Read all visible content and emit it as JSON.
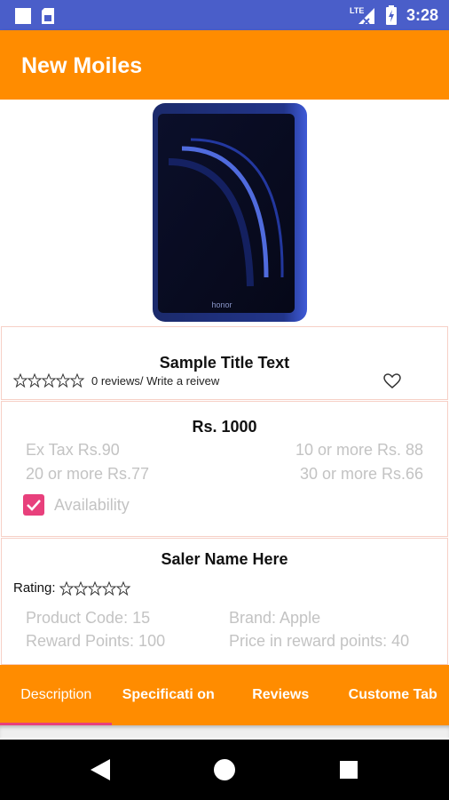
{
  "status_bar": {
    "time": "3:28",
    "network": "LTE",
    "icons": [
      "notification-square-icon",
      "sim-card-icon",
      "signal-icon",
      "battery-charging-icon"
    ]
  },
  "app_bar": {
    "title": "New Moiles"
  },
  "product": {
    "image": "honor-phone",
    "brand_logo_text": "honor",
    "title": "Sample Title Text",
    "rating_stars": 0,
    "reviews_text": "0 reviews/ Write a reivew",
    "price": "Rs. 1000",
    "ex_tax": "Ex Tax Rs.90",
    "bulk_10": "10 or more Rs. 88",
    "bulk_20": "20 or more Rs.77",
    "bulk_30": "30 or more Rs.66",
    "availability_label": "Availability",
    "availability_checked": true
  },
  "seller": {
    "name": "Saler Name Here",
    "rating_label": "Rating:",
    "rating_stars": 0,
    "product_code": "Product Code: 15",
    "brand": "Brand: Apple",
    "reward_points": "Reward Points: 100",
    "price_in_reward_points": "Price in reward points: 40"
  },
  "tabs": [
    {
      "label": "Description",
      "selected": true
    },
    {
      "label": "Specificati on",
      "selected": false
    },
    {
      "label": "Reviews",
      "selected": false
    },
    {
      "label": "Custome Tab",
      "selected": false
    }
  ],
  "colors": {
    "status_bar": "#4a5ec9",
    "accent": "#ff8c00",
    "checkbox": "#e8407c",
    "indicator": "#e8407c"
  }
}
